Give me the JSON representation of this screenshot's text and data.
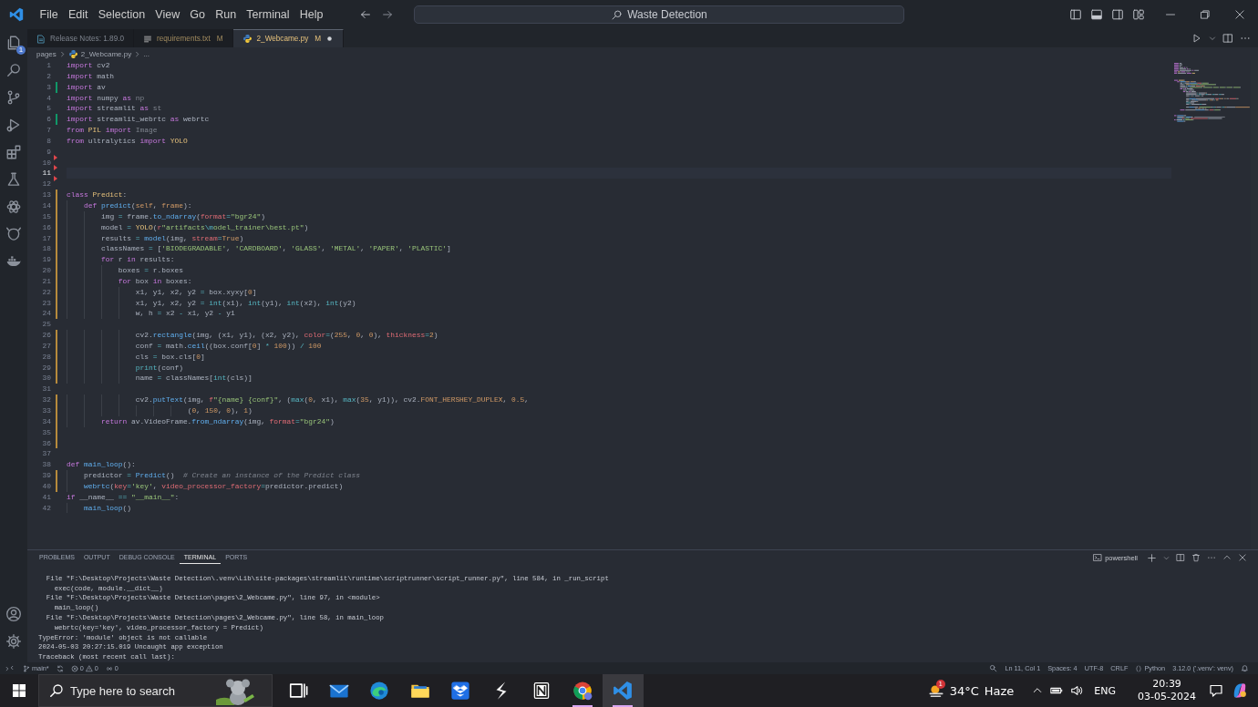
{
  "title_bar": {
    "menu": [
      "File",
      "Edit",
      "Selection",
      "View",
      "Go",
      "Run",
      "Terminal",
      "Help"
    ],
    "search": "Waste Detection"
  },
  "activity_bar": {
    "badge": "1"
  },
  "tabs": [
    {
      "label": "Release Notes: 1.89.0",
      "selected": false,
      "dirty": false
    },
    {
      "label": "requirements.txt",
      "status": "M",
      "selected": false,
      "dirty": false
    },
    {
      "label": "2_Webcame.py",
      "status": "M",
      "selected": true,
      "dirty": true
    }
  ],
  "breadcrumb": [
    "pages",
    "2_Webcame.py",
    "..."
  ],
  "editor": {
    "lines": [
      {
        "n": "1",
        "kind": "unchanged",
        "current": false,
        "tokens": [
          {
            "kind": "kw",
            "text": "import"
          },
          {
            "kind": "p",
            "text": " cv2"
          }
        ]
      },
      {
        "n": "2",
        "kind": "unchanged",
        "current": false,
        "tokens": [
          {
            "kind": "kw",
            "text": "import"
          },
          {
            "kind": "p",
            "text": " math"
          }
        ]
      },
      {
        "n": "3",
        "kind": "added",
        "current": false,
        "tokens": [
          {
            "kind": "kw",
            "text": "import"
          },
          {
            "kind": "p",
            "text": " av"
          }
        ]
      },
      {
        "n": "4",
        "kind": "unchanged",
        "current": false,
        "tokens": [
          {
            "kind": "kw",
            "text": "import"
          },
          {
            "kind": "p",
            "text": " numpy "
          },
          {
            "kind": "kw",
            "text": "as"
          },
          {
            "kind": "dim",
            "text": " np"
          }
        ]
      },
      {
        "n": "5",
        "kind": "unchanged",
        "current": false,
        "tokens": [
          {
            "kind": "kw",
            "text": "import"
          },
          {
            "kind": "p",
            "text": " streamlit "
          },
          {
            "kind": "kw",
            "text": "as"
          },
          {
            "kind": "dim",
            "text": " st"
          }
        ]
      },
      {
        "n": "6",
        "kind": "added",
        "current": false,
        "tokens": [
          {
            "kind": "kw",
            "text": "import"
          },
          {
            "kind": "p",
            "text": " streamlit_webrtc "
          },
          {
            "kind": "kw",
            "text": "as"
          },
          {
            "kind": "p",
            "text": " webrtc"
          }
        ]
      },
      {
        "n": "7",
        "kind": "unchanged",
        "current": false,
        "tokens": [
          {
            "kind": "kw",
            "text": "from "
          },
          {
            "kind": "cls",
            "text": "PIL "
          },
          {
            "kind": "kw",
            "text": "import"
          },
          {
            "kind": "dim",
            "text": " Image"
          }
        ]
      },
      {
        "n": "8",
        "kind": "unchanged",
        "current": false,
        "tokens": [
          {
            "kind": "kw",
            "text": "from"
          },
          {
            "kind": "p",
            "text": " ultralytics "
          },
          {
            "kind": "kw",
            "text": "import "
          },
          {
            "kind": "cls",
            "text": "YOLO"
          }
        ]
      },
      {
        "n": "9",
        "kind": "unchanged",
        "current": false
      },
      {
        "n": "10",
        "kind": "deleted",
        "current": false
      },
      {
        "n": "11",
        "kind": "deleted",
        "current": true
      },
      {
        "n": "12",
        "kind": "deleted",
        "current": false
      },
      {
        "n": "13",
        "kind": "modified",
        "current": false,
        "tokens": [
          {
            "kind": "kw",
            "text": "class "
          },
          {
            "kind": "cls",
            "text": "Predict"
          },
          {
            "kind": "p",
            "text": ":"
          }
        ]
      },
      {
        "n": "14",
        "kind": "modified",
        "current": false,
        "tokens": [
          {
            "kind": "kw",
            "text": "    def "
          },
          {
            "kind": "fn",
            "text": "predict"
          },
          {
            "kind": "p",
            "text": "("
          },
          {
            "kind": "param",
            "text": "self"
          },
          {
            "kind": "p",
            "text": ", "
          },
          {
            "kind": "param",
            "text": "frame"
          },
          {
            "kind": "p",
            "text": "):"
          }
        ]
      },
      {
        "n": "15",
        "kind": "modified",
        "current": false,
        "tokens": [
          {
            "kind": "p",
            "text": "        img "
          },
          {
            "kind": "op",
            "text": "="
          },
          {
            "kind": "p",
            "text": " frame."
          },
          {
            "kind": "fn",
            "text": "to_ndarray"
          },
          {
            "kind": "p",
            "text": "("
          },
          {
            "kind": "kwarg",
            "text": "format"
          },
          {
            "kind": "op",
            "text": "="
          },
          {
            "kind": "str",
            "text": "\"bgr24\""
          },
          {
            "kind": "p",
            "text": ")"
          }
        ]
      },
      {
        "n": "16",
        "kind": "modified",
        "current": false,
        "tokens": [
          {
            "kind": "p",
            "text": "        model "
          },
          {
            "kind": "op",
            "text": "= "
          },
          {
            "kind": "cls",
            "text": "YOLO"
          },
          {
            "kind": "p",
            "text": "("
          },
          {
            "kind": "pre",
            "text": "r"
          },
          {
            "kind": "str",
            "text": "\"artifacts"
          },
          {
            "kind": "esc",
            "text": "\\m"
          },
          {
            "kind": "str",
            "text": "odel_trainer\\best.pt\""
          },
          {
            "kind": "p",
            "text": ")"
          }
        ]
      },
      {
        "n": "17",
        "kind": "modified",
        "current": false,
        "tokens": [
          {
            "kind": "p",
            "text": "        results "
          },
          {
            "kind": "op",
            "text": "= "
          },
          {
            "kind": "fn",
            "text": "model"
          },
          {
            "kind": "p",
            "text": "(img, "
          },
          {
            "kind": "kwarg",
            "text": "stream"
          },
          {
            "kind": "op",
            "text": "="
          },
          {
            "kind": "const",
            "text": "True"
          },
          {
            "kind": "p",
            "text": ")"
          }
        ]
      },
      {
        "n": "18",
        "kind": "modified",
        "current": false,
        "tokens": [
          {
            "kind": "p",
            "text": "        classNames "
          },
          {
            "kind": "op",
            "text": "="
          },
          {
            "kind": "p",
            "text": " ["
          },
          {
            "kind": "str",
            "text": "'BIODEGRADABLE'"
          },
          {
            "kind": "p",
            "text": ", "
          },
          {
            "kind": "str",
            "text": "'CARDBOARD'"
          },
          {
            "kind": "p",
            "text": ", "
          },
          {
            "kind": "str",
            "text": "'GLASS'"
          },
          {
            "kind": "p",
            "text": ", "
          },
          {
            "kind": "str",
            "text": "'METAL'"
          },
          {
            "kind": "p",
            "text": ", "
          },
          {
            "kind": "str",
            "text": "'PAPER'"
          },
          {
            "kind": "p",
            "text": ", "
          },
          {
            "kind": "str",
            "text": "'PLASTIC'"
          },
          {
            "kind": "p",
            "text": "]"
          }
        ]
      },
      {
        "n": "19",
        "kind": "modified",
        "current": false,
        "tokens": [
          {
            "kind": "kw",
            "text": "        for"
          },
          {
            "kind": "p",
            "text": " r "
          },
          {
            "kind": "kw",
            "text": "in"
          },
          {
            "kind": "p",
            "text": " results:"
          }
        ]
      },
      {
        "n": "20",
        "kind": "modified",
        "current": false,
        "tokens": [
          {
            "kind": "p",
            "text": "            boxes "
          },
          {
            "kind": "op",
            "text": "="
          },
          {
            "kind": "p",
            "text": " r.boxes"
          }
        ]
      },
      {
        "n": "21",
        "kind": "modified",
        "current": false,
        "tokens": [
          {
            "kind": "kw",
            "text": "            for"
          },
          {
            "kind": "p",
            "text": " box "
          },
          {
            "kind": "kw",
            "text": "in"
          },
          {
            "kind": "p",
            "text": " boxes:"
          }
        ]
      },
      {
        "n": "22",
        "kind": "modified",
        "current": false,
        "tokens": [
          {
            "kind": "p",
            "text": "                x1, y1, x2, y2 "
          },
          {
            "kind": "op",
            "text": "="
          },
          {
            "kind": "p",
            "text": " box.xyxy["
          },
          {
            "kind": "num",
            "text": "0"
          },
          {
            "kind": "p",
            "text": "]"
          }
        ]
      },
      {
        "n": "23",
        "kind": "modified",
        "current": false,
        "tokens": [
          {
            "kind": "p",
            "text": "                x1, y1, x2, y2 "
          },
          {
            "kind": "op",
            "text": "= "
          },
          {
            "kind": "bi",
            "text": "int"
          },
          {
            "kind": "p",
            "text": "(x1), "
          },
          {
            "kind": "bi",
            "text": "int"
          },
          {
            "kind": "p",
            "text": "(y1), "
          },
          {
            "kind": "bi",
            "text": "int"
          },
          {
            "kind": "p",
            "text": "(x2), "
          },
          {
            "kind": "bi",
            "text": "int"
          },
          {
            "kind": "p",
            "text": "(y2)"
          }
        ]
      },
      {
        "n": "24",
        "kind": "modified",
        "current": false,
        "tokens": [
          {
            "kind": "p",
            "text": "                w, h "
          },
          {
            "kind": "op",
            "text": "="
          },
          {
            "kind": "p",
            "text": " x2 "
          },
          {
            "kind": "op",
            "text": "-"
          },
          {
            "kind": "p",
            "text": " x1, y2 "
          },
          {
            "kind": "op",
            "text": "-"
          },
          {
            "kind": "p",
            "text": " y1"
          }
        ]
      },
      {
        "n": "25",
        "kind": "unchanged",
        "current": false
      },
      {
        "n": "26",
        "kind": "modified",
        "current": false,
        "tokens": [
          {
            "kind": "p",
            "text": "                cv2."
          },
          {
            "kind": "fn",
            "text": "rectangle"
          },
          {
            "kind": "p",
            "text": "(img, (x1, y1), (x2, y2), "
          },
          {
            "kind": "kwarg",
            "text": "color"
          },
          {
            "kind": "op",
            "text": "="
          },
          {
            "kind": "p",
            "text": "("
          },
          {
            "kind": "num",
            "text": "255"
          },
          {
            "kind": "p",
            "text": ", "
          },
          {
            "kind": "num",
            "text": "0"
          },
          {
            "kind": "p",
            "text": ", "
          },
          {
            "kind": "num",
            "text": "0"
          },
          {
            "kind": "p",
            "text": "), "
          },
          {
            "kind": "kwarg",
            "text": "thickness"
          },
          {
            "kind": "op",
            "text": "="
          },
          {
            "kind": "num",
            "text": "2"
          },
          {
            "kind": "p",
            "text": ")"
          }
        ]
      },
      {
        "n": "27",
        "kind": "modified",
        "current": false,
        "tokens": [
          {
            "kind": "p",
            "text": "                conf "
          },
          {
            "kind": "op",
            "text": "="
          },
          {
            "kind": "p",
            "text": " math."
          },
          {
            "kind": "fn",
            "text": "ceil"
          },
          {
            "kind": "p",
            "text": "((box.conf["
          },
          {
            "kind": "num",
            "text": "0"
          },
          {
            "kind": "p",
            "text": "] "
          },
          {
            "kind": "op",
            "text": "* "
          },
          {
            "kind": "num",
            "text": "100"
          },
          {
            "kind": "p",
            "text": ")) "
          },
          {
            "kind": "op",
            "text": "/ "
          },
          {
            "kind": "num",
            "text": "100"
          }
        ]
      },
      {
        "n": "28",
        "kind": "modified",
        "current": false,
        "tokens": [
          {
            "kind": "p",
            "text": "                cls "
          },
          {
            "kind": "op",
            "text": "="
          },
          {
            "kind": "p",
            "text": " box.cls["
          },
          {
            "kind": "num",
            "text": "0"
          },
          {
            "kind": "p",
            "text": "]"
          }
        ]
      },
      {
        "n": "29",
        "kind": "modified",
        "current": false,
        "tokens": [
          {
            "kind": "bi",
            "text": "                print"
          },
          {
            "kind": "p",
            "text": "(conf)"
          }
        ]
      },
      {
        "n": "30",
        "kind": "modified",
        "current": false,
        "tokens": [
          {
            "kind": "p",
            "text": "                name "
          },
          {
            "kind": "op",
            "text": "="
          },
          {
            "kind": "p",
            "text": " classNames["
          },
          {
            "kind": "bi",
            "text": "int"
          },
          {
            "kind": "p",
            "text": "(cls)]"
          }
        ]
      },
      {
        "n": "31",
        "kind": "unchanged",
        "current": false
      },
      {
        "n": "32",
        "kind": "modified",
        "current": false,
        "tokens": [
          {
            "kind": "p",
            "text": "                cv2."
          },
          {
            "kind": "fn",
            "text": "putText"
          },
          {
            "kind": "p",
            "text": "(img, "
          },
          {
            "kind": "pre",
            "text": "f"
          },
          {
            "kind": "str",
            "text": "\"{name} {conf}\""
          },
          {
            "kind": "p",
            "text": ", ("
          },
          {
            "kind": "bi",
            "text": "max"
          },
          {
            "kind": "p",
            "text": "("
          },
          {
            "kind": "num",
            "text": "0"
          },
          {
            "kind": "p",
            "text": ", x1), "
          },
          {
            "kind": "bi",
            "text": "max"
          },
          {
            "kind": "p",
            "text": "("
          },
          {
            "kind": "num",
            "text": "35"
          },
          {
            "kind": "p",
            "text": ", y1)), cv2."
          },
          {
            "kind": "const",
            "text": "FONT_HERSHEY_DUPLEX"
          },
          {
            "kind": "p",
            "text": ", "
          },
          {
            "kind": "num",
            "text": "0.5"
          },
          {
            "kind": "p",
            "text": ","
          }
        ]
      },
      {
        "n": "33",
        "kind": "modified",
        "current": false,
        "tokens": [
          {
            "kind": "p",
            "text": "                            ("
          },
          {
            "kind": "num",
            "text": "0"
          },
          {
            "kind": "p",
            "text": ", "
          },
          {
            "kind": "num",
            "text": "150"
          },
          {
            "kind": "p",
            "text": ", "
          },
          {
            "kind": "num",
            "text": "0"
          },
          {
            "kind": "p",
            "text": "), "
          },
          {
            "kind": "num",
            "text": "1"
          },
          {
            "kind": "p",
            "text": ")"
          }
        ]
      },
      {
        "n": "34",
        "kind": "modified",
        "current": false,
        "tokens": [
          {
            "kind": "kw",
            "text": "        return"
          },
          {
            "kind": "p",
            "text": " av.VideoFrame."
          },
          {
            "kind": "fn",
            "text": "from_ndarray"
          },
          {
            "kind": "p",
            "text": "(img, "
          },
          {
            "kind": "kwarg",
            "text": "format"
          },
          {
            "kind": "op",
            "text": "="
          },
          {
            "kind": "str",
            "text": "\"bgr24\""
          },
          {
            "kind": "p",
            "text": ")"
          }
        ]
      },
      {
        "n": "35",
        "kind": "modified",
        "current": false
      },
      {
        "n": "36",
        "kind": "modified",
        "current": false
      },
      {
        "n": "37",
        "kind": "unchanged",
        "current": false
      },
      {
        "n": "38",
        "kind": "unchanged",
        "current": false,
        "tokens": [
          {
            "kind": "kw",
            "text": "def "
          },
          {
            "kind": "fn",
            "text": "main_loop"
          },
          {
            "kind": "p",
            "text": "():"
          }
        ]
      },
      {
        "n": "39",
        "kind": "modified",
        "current": false,
        "tokens": [
          {
            "kind": "p",
            "text": "    predictor "
          },
          {
            "kind": "op",
            "text": "= "
          },
          {
            "kind": "fn",
            "text": "Predict"
          },
          {
            "kind": "p",
            "text": "()  "
          },
          {
            "kind": "cm",
            "text": "# Create an instance of the Predict class"
          }
        ]
      },
      {
        "n": "40",
        "kind": "modified",
        "current": false,
        "tokens": [
          {
            "kind": "fn",
            "text": "    webrtc"
          },
          {
            "kind": "p",
            "text": "("
          },
          {
            "kind": "kwarg",
            "text": "key"
          },
          {
            "kind": "op",
            "text": "="
          },
          {
            "kind": "str",
            "text": "'key'"
          },
          {
            "kind": "p",
            "text": ", "
          },
          {
            "kind": "kwarg",
            "text": "video_processor_factory"
          },
          {
            "kind": "op",
            "text": "="
          },
          {
            "kind": "p",
            "text": "predictor.predict)"
          }
        ]
      },
      {
        "n": "41",
        "kind": "unchanged",
        "current": false,
        "tokens": [
          {
            "kind": "kw",
            "text": "if"
          },
          {
            "kind": "p",
            "text": " __name__ "
          },
          {
            "kind": "op",
            "text": "== "
          },
          {
            "kind": "str",
            "text": "\"__main__\""
          },
          {
            "kind": "p",
            "text": ":"
          }
        ]
      },
      {
        "n": "42",
        "kind": "unchanged",
        "current": false,
        "tokens": [
          {
            "kind": "fn",
            "text": "    main_loop"
          },
          {
            "kind": "p",
            "text": "()"
          }
        ]
      }
    ]
  },
  "panel": {
    "tabs": [
      {
        "label": "PROBLEMS",
        "selected": false
      },
      {
        "label": "OUTPUT",
        "selected": false
      },
      {
        "label": "DEBUG CONSOLE",
        "selected": false
      },
      {
        "label": "TERMINAL",
        "selected": true
      },
      {
        "label": "PORTS",
        "selected": false
      }
    ],
    "shell": "powershell",
    "terminal": [
      "  File \"F:\\Desktop\\Projects\\Waste Detection\\.venv\\Lib\\site-packages\\streamlit\\runtime\\scriptrunner\\script_runner.py\", line 584, in _run_script",
      "    exec(code, module.__dict__)",
      "  File \"F:\\Desktop\\Projects\\Waste Detection\\pages\\2_Webcame.py\", line 97, in <module>",
      "    main_loop()",
      "  File \"F:\\Desktop\\Projects\\Waste Detection\\pages\\2_Webcame.py\", line 58, in main_loop",
      "    webrtc(key='key', video_processor_factory = Predict)",
      "TypeError: 'module' object is not callable",
      "2024-05-03 20:27:15.019 Uncaught app exception",
      "Traceback (most recent call last):"
    ]
  },
  "status_bar": {
    "branch": "main*",
    "errors": "0",
    "warnings": "0",
    "ports": "0",
    "items": [
      "Ln 11, Col 1",
      "Spaces: 4",
      "UTF-8",
      "CRLF",
      "Python",
      "3.12.0 ('.venv': venv)"
    ]
  },
  "taskbar": {
    "search": {
      "placeholder": "Type here to search"
    },
    "apps": [
      {
        "running": false,
        "selected": false
      },
      {
        "running": false,
        "selected": false
      },
      {
        "running": false,
        "selected": false
      },
      {
        "running": false,
        "selected": false
      },
      {
        "running": false,
        "selected": false
      },
      {
        "running": false,
        "selected": false
      },
      {
        "running": false,
        "selected": false
      },
      {
        "running": true,
        "selected": false
      },
      {
        "running": true,
        "selected": true
      }
    ],
    "weather": {
      "badge": "1",
      "temperature": "34°C",
      "condition": "Haze"
    },
    "language": "ENG",
    "time": "20:39",
    "date": "03-05-2024"
  }
}
